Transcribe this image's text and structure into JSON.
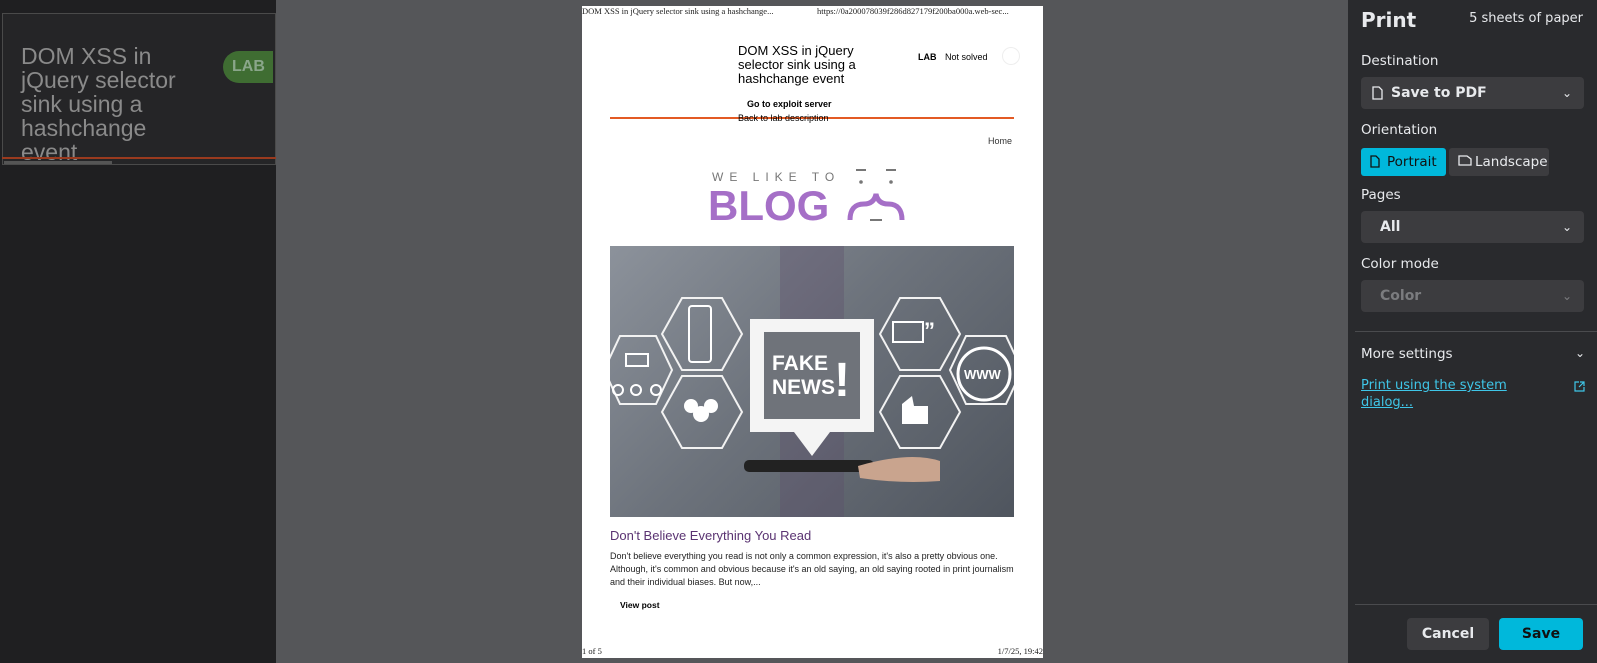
{
  "background_page": {
    "title": "DOM XSS in jQuery selector sink using a hashchange event",
    "lab_badge": "LAB"
  },
  "sheet": {
    "header_left": "DOM XSS in jQuery selector sink using a hashchange...",
    "header_right": "https://0a200078039f286d827179f200ba000a.web-sec...",
    "lab_title": "DOM XSS in jQuery selector sink using a hashchange event",
    "lab_label": "LAB",
    "status": "Not solved",
    "exploit_link": "Go to exploit server",
    "back_link": "Back to lab description",
    "home_link": "Home",
    "logo_top": "WE LIKE TO",
    "logo_main": "BLOG",
    "hero_sign_line1": "FAKE",
    "hero_sign_line2": "NEWS",
    "hero_sign_mark": "!",
    "hero_web_label": "WWW",
    "post_title": "Don't Believe Everything You Read",
    "post_excerpt": "Don't believe everything you read is not only a common expression, it's also a pretty obvious one. Although, it's common and obvious because it's an old saying, an old saying rooted in print journalism and their individual biases. But now,...",
    "view_post": "View post",
    "footer_left": "1 of 5",
    "footer_right": "1/7/25, 19:42"
  },
  "print_panel": {
    "title": "Print",
    "sheets": "5 sheets of paper",
    "destination_label": "Destination",
    "destination_value": "Save to PDF",
    "orientation_label": "Orientation",
    "orientation_portrait": "Portrait",
    "orientation_landscape": "Landscape",
    "orientation_selected": "Portrait",
    "pages_label": "Pages",
    "pages_value": "All",
    "color_mode_label": "Color mode",
    "color_mode_value": "Color",
    "more_settings": "More settings",
    "system_dialog_link": "Print using the system dialog...",
    "cancel": "Cancel",
    "save": "Save"
  },
  "colors": {
    "accent": "#00b8db",
    "panel_bg": "#292a2d",
    "preview_bg": "#555659",
    "lab_orange": "#e35a24",
    "blog_purple": "#a56fc7"
  }
}
